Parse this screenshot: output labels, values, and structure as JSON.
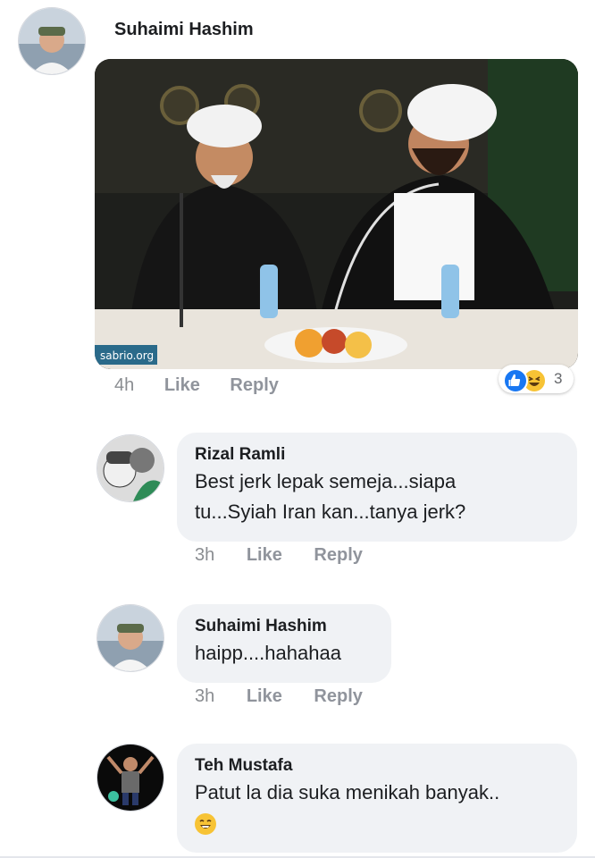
{
  "post": {
    "author": "Suhaimi Hashim",
    "photo_watermark": "sabrio.org",
    "time": "4h",
    "like_label": "Like",
    "reply_label": "Reply",
    "reactions": {
      "icons": [
        "like-icon",
        "haha-icon"
      ],
      "count": "3"
    }
  },
  "comments": [
    {
      "author": "Rizal Ramli",
      "lines": [
        "Best jerk lepak semeja...siapa",
        "tu...Syiah Iran kan...tanya jerk?"
      ],
      "time": "3h",
      "like_label": "Like",
      "reply_label": "Reply"
    },
    {
      "author": "Suhaimi Hashim",
      "lines": [
        "haipp....hahahaa"
      ],
      "time": "3h",
      "like_label": "Like",
      "reply_label": "Reply"
    },
    {
      "author": "Teh Mustafa",
      "lines": [
        "Patut la dia suka menikah banyak.."
      ],
      "emoji": "laughing-emoji-icon"
    }
  ],
  "colors": {
    "bubble": "#f0f2f5",
    "meta_text": "#8a8d91",
    "like_blue": "#1877f2",
    "haha_yellow": "#f7c335"
  }
}
